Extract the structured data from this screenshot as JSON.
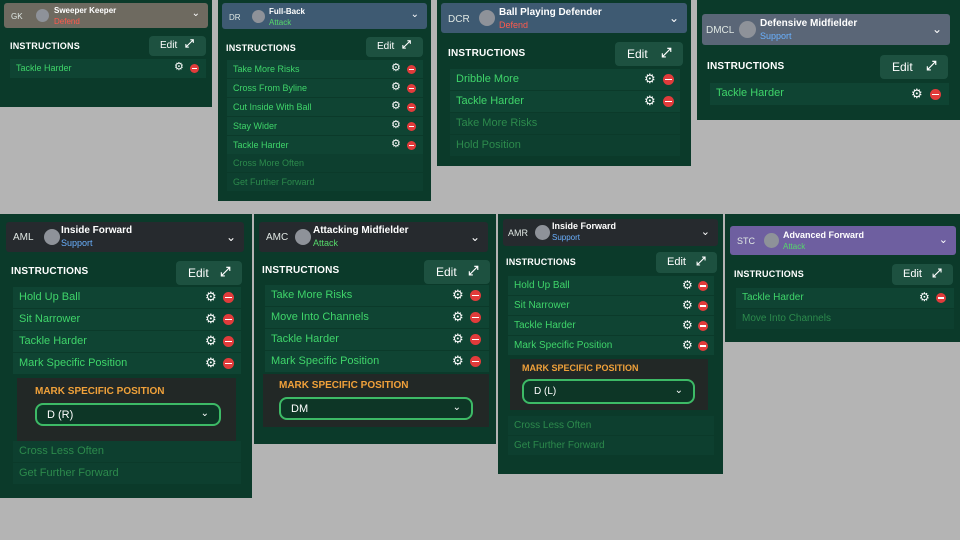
{
  "common": {
    "instructions_label": "INSTRUCTIONS",
    "edit_label": "Edit",
    "chevron": "⌄",
    "gear": "⚙",
    "edit_icon_name": "expand-icon",
    "colors": {
      "panel_bg": "#0b3a2a",
      "row_text_active": "#3fd56a",
      "row_text_inactive": "#2c8a4c",
      "defend": "#ff5a4d",
      "attack": "#55d86a",
      "support": "#6ab1ff",
      "subbox_title": "#f0a13a",
      "dropdown_border": "#3dba66"
    }
  },
  "panels": [
    {
      "pos": "GK",
      "role": "Sweeper Keeper",
      "duty": "Defend",
      "instructions": [
        "Tackle Harder"
      ],
      "available": []
    },
    {
      "pos": "DR",
      "role": "Full-Back",
      "duty": "Attack",
      "instructions": [
        "Take More Risks",
        "Cross From Byline",
        "Cut Inside With Ball",
        "Stay Wider",
        "Tackle Harder"
      ],
      "available": [
        "Cross More Often",
        "Get Further Forward"
      ]
    },
    {
      "pos": "DCR",
      "role": "Ball Playing Defender",
      "duty": "Defend",
      "instructions": [
        "Dribble More",
        "Tackle Harder"
      ],
      "available": [
        "Take More Risks",
        "Hold Position"
      ]
    },
    {
      "pos": "DMCL",
      "role": "Defensive Midfielder",
      "duty": "Support",
      "instructions": [
        "Tackle Harder"
      ],
      "available": []
    },
    {
      "pos": "AML",
      "role": "Inside Forward",
      "duty": "Support",
      "instructions": [
        "Hold Up Ball",
        "Sit Narrower",
        "Tackle Harder",
        "Mark Specific Position"
      ],
      "sub": {
        "title": "MARK SPECIFIC POSITION",
        "value": "D (R)"
      },
      "available": [
        "Cross Less Often",
        "Get Further Forward"
      ]
    },
    {
      "pos": "AMC",
      "role": "Attacking Midfielder",
      "duty": "Attack",
      "instructions": [
        "Take More Risks",
        "Move Into Channels",
        "Tackle Harder",
        "Mark Specific Position"
      ],
      "sub": {
        "title": "MARK SPECIFIC POSITION",
        "value": "DM"
      },
      "available": []
    },
    {
      "pos": "AMR",
      "role": "Inside Forward",
      "duty": "Support",
      "instructions": [
        "Hold Up Ball",
        "Sit Narrower",
        "Tackle Harder",
        "Mark Specific Position"
      ],
      "sub": {
        "title": "MARK SPECIFIC POSITION",
        "value": "D (L)"
      },
      "available": [
        "Cross Less Often",
        "Get Further Forward"
      ]
    },
    {
      "pos": "STC",
      "role": "Advanced Forward",
      "duty": "Attack",
      "instructions": [
        "Tackle Harder"
      ],
      "available": [
        "Move Into Channels"
      ]
    }
  ]
}
